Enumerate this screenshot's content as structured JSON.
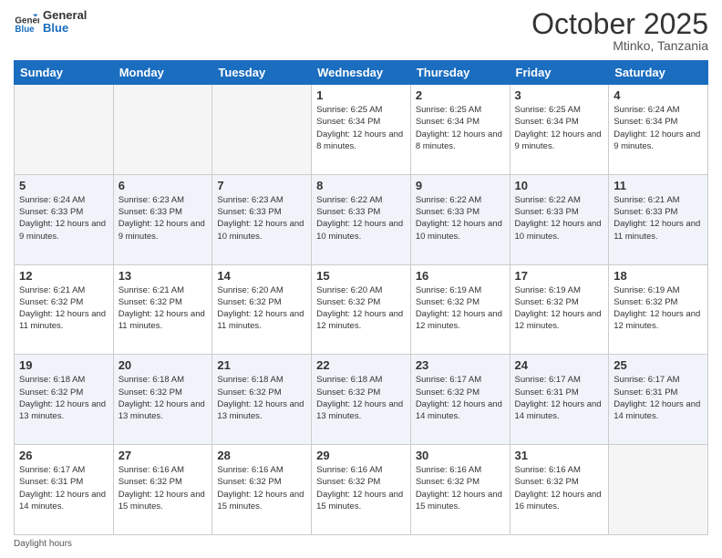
{
  "logo": {
    "line1": "General",
    "line2": "Blue"
  },
  "title": "October 2025",
  "subtitle": "Mtinko, Tanzania",
  "days_of_week": [
    "Sunday",
    "Monday",
    "Tuesday",
    "Wednesday",
    "Thursday",
    "Friday",
    "Saturday"
  ],
  "footer": "Daylight hours",
  "weeks": [
    [
      {
        "day": "",
        "info": ""
      },
      {
        "day": "",
        "info": ""
      },
      {
        "day": "",
        "info": ""
      },
      {
        "day": "1",
        "info": "Sunrise: 6:25 AM\nSunset: 6:34 PM\nDaylight: 12 hours and 8 minutes."
      },
      {
        "day": "2",
        "info": "Sunrise: 6:25 AM\nSunset: 6:34 PM\nDaylight: 12 hours and 8 minutes."
      },
      {
        "day": "3",
        "info": "Sunrise: 6:25 AM\nSunset: 6:34 PM\nDaylight: 12 hours and 9 minutes."
      },
      {
        "day": "4",
        "info": "Sunrise: 6:24 AM\nSunset: 6:34 PM\nDaylight: 12 hours and 9 minutes."
      }
    ],
    [
      {
        "day": "5",
        "info": "Sunrise: 6:24 AM\nSunset: 6:33 PM\nDaylight: 12 hours and 9 minutes."
      },
      {
        "day": "6",
        "info": "Sunrise: 6:23 AM\nSunset: 6:33 PM\nDaylight: 12 hours and 9 minutes."
      },
      {
        "day": "7",
        "info": "Sunrise: 6:23 AM\nSunset: 6:33 PM\nDaylight: 12 hours and 10 minutes."
      },
      {
        "day": "8",
        "info": "Sunrise: 6:22 AM\nSunset: 6:33 PM\nDaylight: 12 hours and 10 minutes."
      },
      {
        "day": "9",
        "info": "Sunrise: 6:22 AM\nSunset: 6:33 PM\nDaylight: 12 hours and 10 minutes."
      },
      {
        "day": "10",
        "info": "Sunrise: 6:22 AM\nSunset: 6:33 PM\nDaylight: 12 hours and 10 minutes."
      },
      {
        "day": "11",
        "info": "Sunrise: 6:21 AM\nSunset: 6:33 PM\nDaylight: 12 hours and 11 minutes."
      }
    ],
    [
      {
        "day": "12",
        "info": "Sunrise: 6:21 AM\nSunset: 6:32 PM\nDaylight: 12 hours and 11 minutes."
      },
      {
        "day": "13",
        "info": "Sunrise: 6:21 AM\nSunset: 6:32 PM\nDaylight: 12 hours and 11 minutes."
      },
      {
        "day": "14",
        "info": "Sunrise: 6:20 AM\nSunset: 6:32 PM\nDaylight: 12 hours and 11 minutes."
      },
      {
        "day": "15",
        "info": "Sunrise: 6:20 AM\nSunset: 6:32 PM\nDaylight: 12 hours and 12 minutes."
      },
      {
        "day": "16",
        "info": "Sunrise: 6:19 AM\nSunset: 6:32 PM\nDaylight: 12 hours and 12 minutes."
      },
      {
        "day": "17",
        "info": "Sunrise: 6:19 AM\nSunset: 6:32 PM\nDaylight: 12 hours and 12 minutes."
      },
      {
        "day": "18",
        "info": "Sunrise: 6:19 AM\nSunset: 6:32 PM\nDaylight: 12 hours and 12 minutes."
      }
    ],
    [
      {
        "day": "19",
        "info": "Sunrise: 6:18 AM\nSunset: 6:32 PM\nDaylight: 12 hours and 13 minutes."
      },
      {
        "day": "20",
        "info": "Sunrise: 6:18 AM\nSunset: 6:32 PM\nDaylight: 12 hours and 13 minutes."
      },
      {
        "day": "21",
        "info": "Sunrise: 6:18 AM\nSunset: 6:32 PM\nDaylight: 12 hours and 13 minutes."
      },
      {
        "day": "22",
        "info": "Sunrise: 6:18 AM\nSunset: 6:32 PM\nDaylight: 12 hours and 13 minutes."
      },
      {
        "day": "23",
        "info": "Sunrise: 6:17 AM\nSunset: 6:32 PM\nDaylight: 12 hours and 14 minutes."
      },
      {
        "day": "24",
        "info": "Sunrise: 6:17 AM\nSunset: 6:31 PM\nDaylight: 12 hours and 14 minutes."
      },
      {
        "day": "25",
        "info": "Sunrise: 6:17 AM\nSunset: 6:31 PM\nDaylight: 12 hours and 14 minutes."
      }
    ],
    [
      {
        "day": "26",
        "info": "Sunrise: 6:17 AM\nSunset: 6:31 PM\nDaylight: 12 hours and 14 minutes."
      },
      {
        "day": "27",
        "info": "Sunrise: 6:16 AM\nSunset: 6:32 PM\nDaylight: 12 hours and 15 minutes."
      },
      {
        "day": "28",
        "info": "Sunrise: 6:16 AM\nSunset: 6:32 PM\nDaylight: 12 hours and 15 minutes."
      },
      {
        "day": "29",
        "info": "Sunrise: 6:16 AM\nSunset: 6:32 PM\nDaylight: 12 hours and 15 minutes."
      },
      {
        "day": "30",
        "info": "Sunrise: 6:16 AM\nSunset: 6:32 PM\nDaylight: 12 hours and 15 minutes."
      },
      {
        "day": "31",
        "info": "Sunrise: 6:16 AM\nSunset: 6:32 PM\nDaylight: 12 hours and 16 minutes."
      },
      {
        "day": "",
        "info": ""
      }
    ]
  ]
}
